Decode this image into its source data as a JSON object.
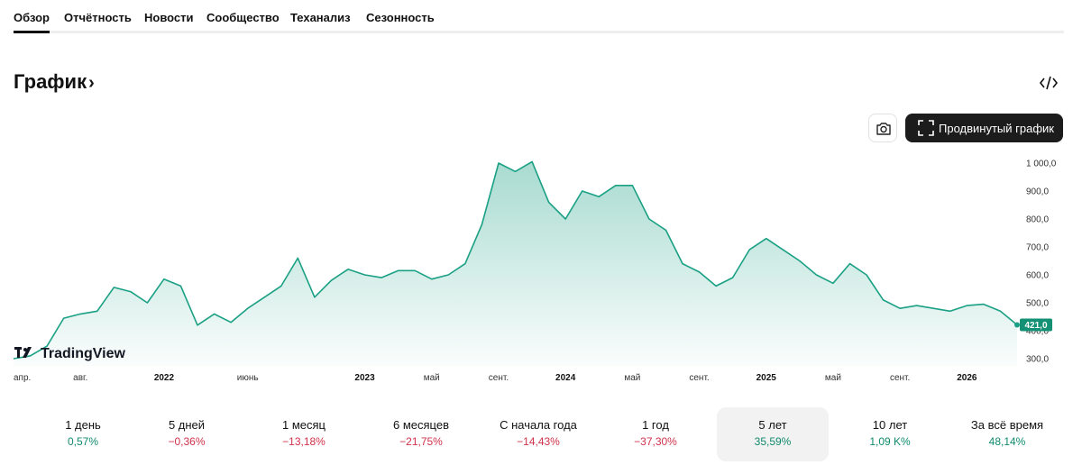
{
  "tabs": [
    {
      "label": "Обзор",
      "active": true
    },
    {
      "label": "Отчётность",
      "active": false
    },
    {
      "label": "Новости",
      "active": false
    },
    {
      "label": "Сообщество",
      "active": false
    },
    {
      "label": "Теханализ",
      "active": false
    },
    {
      "label": "Сезонность",
      "active": false
    }
  ],
  "section": {
    "title": "График",
    "chevron": "›"
  },
  "toolbar": {
    "embed_icon": "code-embed-icon",
    "camera_icon": "camera-icon",
    "advanced_label": "Продвинутый график",
    "advanced_icon": "fullscreen-icon"
  },
  "colors": {
    "line": "#1aa084",
    "accent_positive": "#108a6c",
    "accent_negative": "#d1324a",
    "button_dark": "#1c1c1c"
  },
  "chart_data": {
    "type": "area",
    "watermark": "TradingView",
    "current_value": 421,
    "current_value_label": "421,0",
    "ylim": [
      280,
      1030
    ],
    "y_ticks": [
      {
        "value": 300,
        "label": "300,0"
      },
      {
        "value": 400,
        "label": "400,0"
      },
      {
        "value": 500,
        "label": "500,0"
      },
      {
        "value": 600,
        "label": "600,0"
      },
      {
        "value": 700,
        "label": "700,0"
      },
      {
        "value": 800,
        "label": "800,0"
      },
      {
        "value": 900,
        "label": "900,0"
      },
      {
        "value": 1000,
        "label": "1 000,0"
      }
    ],
    "x_range": [
      "2021-04",
      "2026-04"
    ],
    "x_ticks": [
      {
        "date": "2021-04",
        "label": "апр.",
        "bold": false
      },
      {
        "date": "2021-08",
        "label": "авг.",
        "bold": false
      },
      {
        "date": "2022-01",
        "label": "2022",
        "bold": true
      },
      {
        "date": "2022-06",
        "label": "июнь",
        "bold": false
      },
      {
        "date": "2023-01",
        "label": "2023",
        "bold": true
      },
      {
        "date": "2023-05",
        "label": "май",
        "bold": false
      },
      {
        "date": "2023-09",
        "label": "сент.",
        "bold": false
      },
      {
        "date": "2024-01",
        "label": "2024",
        "bold": true
      },
      {
        "date": "2024-05",
        "label": "май",
        "bold": false
      },
      {
        "date": "2024-09",
        "label": "сент.",
        "bold": false
      },
      {
        "date": "2025-01",
        "label": "2025",
        "bold": true
      },
      {
        "date": "2025-05",
        "label": "май",
        "bold": false
      },
      {
        "date": "2025-09",
        "label": "сент.",
        "bold": false
      },
      {
        "date": "2026-01",
        "label": "2026",
        "bold": true
      }
    ],
    "series": [
      {
        "x": [
          "2021-04",
          "2021-05",
          "2021-06",
          "2021-07",
          "2021-08",
          "2021-09",
          "2021-10",
          "2021-11",
          "2021-12",
          "2022-01",
          "2022-02",
          "2022-03",
          "2022-04",
          "2022-05",
          "2022-06",
          "2022-07",
          "2022-08",
          "2022-09",
          "2022-10",
          "2022-11",
          "2022-12",
          "2023-01",
          "2023-02",
          "2023-03",
          "2023-04",
          "2023-05",
          "2023-06",
          "2023-07",
          "2023-08",
          "2023-09",
          "2023-10",
          "2023-11",
          "2023-12",
          "2024-01",
          "2024-02",
          "2024-03",
          "2024-04",
          "2024-05",
          "2024-06",
          "2024-07",
          "2024-08",
          "2024-09",
          "2024-10",
          "2024-11",
          "2024-12",
          "2025-01",
          "2025-02",
          "2025-03",
          "2025-04",
          "2025-05",
          "2025-06",
          "2025-07",
          "2025-08",
          "2025-09",
          "2025-10",
          "2025-11",
          "2025-12",
          "2026-01",
          "2026-02",
          "2026-03",
          "2026-04"
        ],
        "values": [
          300,
          310,
          345,
          445,
          460,
          470,
          555,
          540,
          500,
          585,
          560,
          420,
          460,
          430,
          480,
          520,
          560,
          660,
          520,
          580,
          620,
          600,
          590,
          615,
          615,
          585,
          600,
          640,
          780,
          1000,
          970,
          1005,
          860,
          800,
          900,
          880,
          920,
          920,
          800,
          760,
          640,
          610,
          560,
          590,
          690,
          730,
          690,
          650,
          600,
          570,
          640,
          600,
          510,
          480,
          490,
          480,
          470,
          490,
          495,
          470,
          421
        ]
      }
    ]
  },
  "periods": [
    {
      "label": "1 день",
      "value": "0,57%",
      "sign": "pos",
      "selected": false
    },
    {
      "label": "5 дней",
      "value": "−0,36%",
      "sign": "neg",
      "selected": false
    },
    {
      "label": "1 месяц",
      "value": "−13,18%",
      "sign": "neg",
      "selected": false
    },
    {
      "label": "6 месяцев",
      "value": "−21,75%",
      "sign": "neg",
      "selected": false
    },
    {
      "label": "С начала года",
      "value": "−14,43%",
      "sign": "neg",
      "selected": false
    },
    {
      "label": "1 год",
      "value": "−37,30%",
      "sign": "neg",
      "selected": false
    },
    {
      "label": "5 лет",
      "value": "35,59%",
      "sign": "pos",
      "selected": true
    },
    {
      "label": "10 лет",
      "value": "1,09 K%",
      "sign": "pos",
      "selected": false
    },
    {
      "label": "За всё время",
      "value": "48,14%",
      "sign": "pos",
      "selected": false
    }
  ]
}
